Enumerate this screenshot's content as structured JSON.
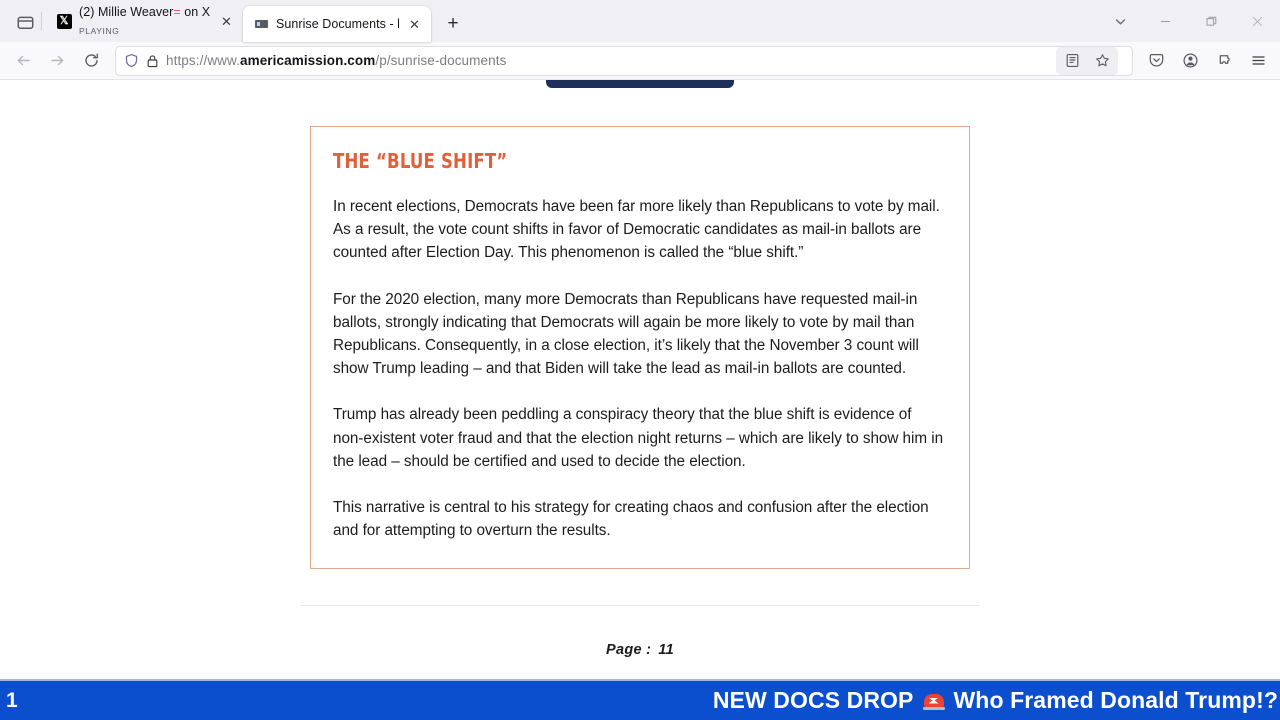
{
  "browser": {
    "firefox_view_label": "Firefox View",
    "tabs": [
      {
        "title": "(2) Millie Weaver",
        "title_mark": "=",
        "title_rest": " on X: \"Octo",
        "subtitle": "PLAYING",
        "favicon": "x-logo-icon",
        "active": false
      },
      {
        "title": "Sunrise Documents - by Americ",
        "subtitle": "",
        "favicon": "generic-page-icon",
        "active": true
      }
    ],
    "new_tab_label": "+",
    "close_label": "✕",
    "nav": {
      "back": "back-arrow-icon",
      "forward": "forward-arrow-icon",
      "reload": "reload-icon"
    },
    "url": {
      "prefix": "https://www.",
      "domain": "americamission.com",
      "path": "/p/sunrise-documents",
      "shield_icon": "tracking-protection-shield-icon",
      "lock_icon": "padlock-icon"
    },
    "url_actions": [
      "reader-view-icon",
      "bookmark-star-icon"
    ],
    "toolbar_right": [
      "pocket-save-icon",
      "account-icon",
      "extensions-icon",
      "app-menu-icon"
    ],
    "window_controls": [
      "list-all-tabs-icon",
      "minimize-icon",
      "restore-icon",
      "close-icon"
    ]
  },
  "document": {
    "heading": "THE “BLUE SHIFT”",
    "paragraphs": [
      "In recent elections, Democrats have been far more likely than Republicans to vote by mail. As a result, the vote count shifts in favor of Democratic candidates as mail-in ballots are counted after Election Day. This phenomenon is called the “blue shift.”",
      "For the 2020 election, many more Democrats than Republicans have requested mail-in ballots, strongly indicating that Democrats will again be more likely to vote by mail than Republicans. Consequently, in a close election, it’s likely that the November 3 count will show Trump leading – and that Biden will take the lead as mail-in ballots are counted.",
      "Trump has already been peddling a conspiracy theory that the blue shift is evidence of non-existent voter fraud and that the election night returns – which are likely to show him in the lead – should be certified and used to decide the election.",
      "This narrative is central to his strategy for creating chaos and confusion after the election and for attempting to overturn the results."
    ],
    "page_label": "Page :",
    "page_number": "11",
    "border_color": "#e0a98c",
    "heading_color": "#e0603a"
  },
  "banner": {
    "left_number": "1",
    "text": "NEW DOCS DROP",
    "icon": "siren-light-icon",
    "text_after": "Who Framed Donald Trump!?",
    "background_color": "#0b4fce",
    "text_color": "#ffffff"
  }
}
